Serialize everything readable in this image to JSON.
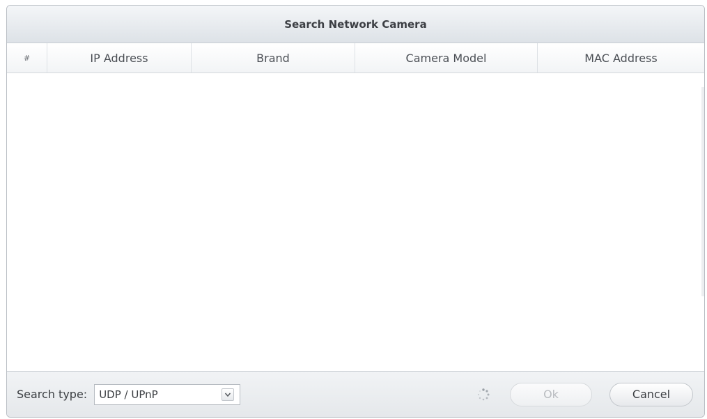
{
  "dialog": {
    "title": "Search Network Camera"
  },
  "table": {
    "columns": [
      "#",
      "IP Address",
      "Brand",
      "Camera Model",
      "MAC Address"
    ],
    "rows": []
  },
  "footer": {
    "search_type_label": "Search type:",
    "search_type_value": "UDP / UPnP",
    "ok_label": "Ok",
    "cancel_label": "Cancel"
  },
  "icons": {
    "dropdown": "chevron-down-icon",
    "spinner": "loading-spinner-icon"
  }
}
